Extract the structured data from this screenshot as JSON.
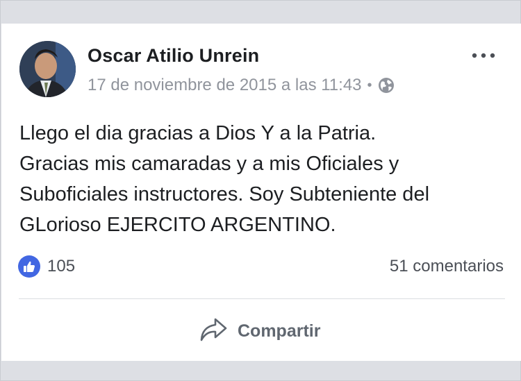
{
  "post": {
    "author": "Oscar Atilio Unrein",
    "timestamp": "17 de noviembre de 2015 a las 11:43",
    "separator": "•",
    "privacy_icon": "globe-icon",
    "more_icon": "ellipsis-icon",
    "text_lines": [
      "Llego el dia gracias a Dios Y a la Patria.",
      "Gracias mis camaradas y a mis Oficiales y",
      "Suboficiales instructores. Soy Subteniente del",
      "GLorioso EJERCITO ARGENTINO."
    ]
  },
  "stats": {
    "like_icon": "thumbs-up-icon",
    "likes": "105",
    "comments": "51 comentarios"
  },
  "actions": {
    "share_icon": "share-arrow-icon",
    "share_label": "Compartir"
  },
  "colors": {
    "background": "#dddfe4",
    "card": "#ffffff",
    "text": "#1c1e21",
    "muted": "#90949c",
    "like_blue": "#4267e2"
  }
}
